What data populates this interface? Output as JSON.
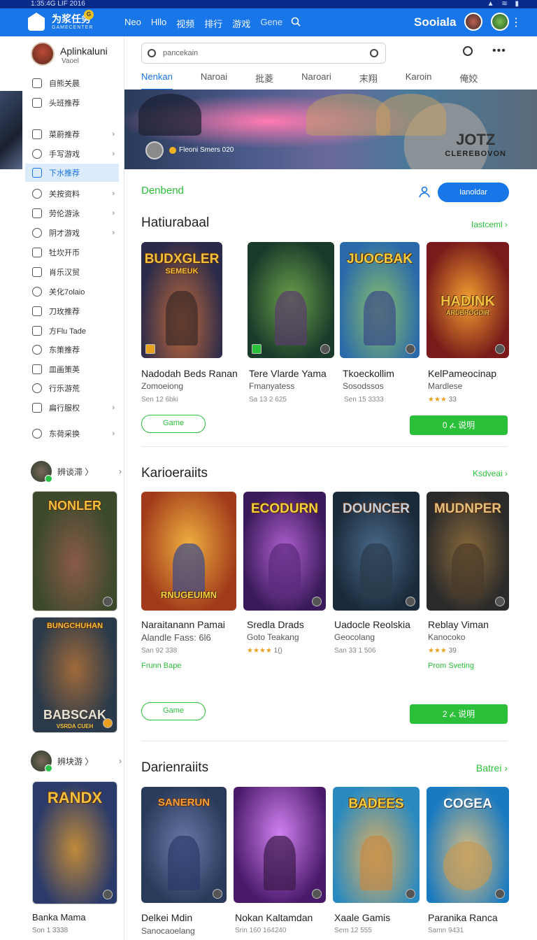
{
  "status": {
    "text": "1:35:4G  LIF 2016",
    "icons": "▲ ≋ ▮"
  },
  "header": {
    "brand": "为浆任务",
    "brand_badge": "G",
    "brand_sub": "GAMECENTER",
    "nav": [
      "Neo",
      "Hllo",
      "视频",
      "排行",
      "游戏",
      "Gene"
    ],
    "social": "Sooiala"
  },
  "sidebar": {
    "profile_name": "Aplinkaluni",
    "profile_sub": "Vaoel",
    "items": [
      {
        "label": "自熊关晨",
        "chev": false
      },
      {
        "label": "头班推荐",
        "chev": false
      },
      {
        "label": "菜蔚推荐",
        "chev": true
      },
      {
        "label": "手写游戏",
        "chev": true
      },
      {
        "label": "下水推荐",
        "chev": false,
        "active": true
      },
      {
        "label": "关按资料",
        "chev": true
      },
      {
        "label": "劳伦游泳",
        "chev": true
      },
      {
        "label": "阴才游戏",
        "chev": true
      },
      {
        "label": "牡坎开币",
        "chev": false
      },
      {
        "label": "肖乐汉贸",
        "chev": false
      },
      {
        "label": "关化7olaio",
        "chev": false
      },
      {
        "label": "刀玫推荐",
        "chev": false
      },
      {
        "label": "方Flu Tade",
        "chev": false
      },
      {
        "label": "东策推荐",
        "chev": false
      },
      {
        "label": "皿画策英",
        "chev": false
      },
      {
        "label": "行乐游荒",
        "chev": false
      },
      {
        "label": "扁行服权",
        "chev": true
      },
      {
        "label": "东荷采换",
        "chev": true
      }
    ],
    "friends": [
      {
        "label": "辨谈滞 〉"
      },
      {
        "label": "辨块游 〉"
      }
    ],
    "cards": [
      {
        "title": "NONLER"
      },
      {
        "title": "BABSCAK",
        "top": "BUNGCHUHAN",
        "subtitle": "VSRDA CUEH"
      },
      {
        "title": "RANDX"
      }
    ],
    "bottom_name": "Banka Mama",
    "bottom_sub": "Son 1 3338"
  },
  "main": {
    "search_placeholder": "pancekain",
    "tabs": [
      "Nenkan",
      "Naroai",
      "批菱",
      "Naroari",
      "末翔",
      "Karoin",
      "俺姣"
    ],
    "hero": {
      "caption": "Fleoni Smers 020",
      "logo_main": "JOTZ",
      "logo_sub": "CLEREBOVON"
    },
    "featured_label": "Denbend",
    "primary_button": "Ianoldar",
    "sections": [
      {
        "title": "Hatiurabaal",
        "link": "Iastceml ›",
        "games": [
          {
            "art": "BUDXGLER",
            "art_sub": "SEMEUK",
            "name": "Nadodah Beds Ranan",
            "sub": "Zomoeiong",
            "meta": "Sen 12 6bki"
          },
          {
            "art": "",
            "name": "Tere Vlarde Yama",
            "sub": "Fmanyatess",
            "meta": "Sa 13 2 625"
          },
          {
            "art": "JUOCBAK",
            "name": "Tkoeckollim",
            "sub": "Sosodssos",
            "meta": "Sen 15 3333"
          },
          {
            "art": "HADINK",
            "art_sub": "ARUBROGDIR",
            "name": "KelPameocinap",
            "sub": "Mardlese",
            "stars": "★★★",
            "rating": "33"
          }
        ],
        "outline_button": "Game",
        "green_button": "0 ፈ 说明"
      },
      {
        "title": "Karioeraiits",
        "link": "Ksdveai ›",
        "games": [
          {
            "art": "RNUGEUIMN",
            "name": "Naraitanann Pamai",
            "sub": "Alandle Fass: 6l6",
            "meta": "San 92 338",
            "green": "Frunn Bape"
          },
          {
            "art": "ECODURN",
            "name": "Sredla Drads",
            "sub": "Goto Teakang",
            "stars": "★★★★",
            "rating": "1()"
          },
          {
            "art": "DOUNCER",
            "name": "Uadocle Reolskia",
            "sub": "Geocolang",
            "meta": "San 33 1 506"
          },
          {
            "art": "MUDNPER",
            "name": "Reblay Viman",
            "sub": "Kanocoko",
            "stars": "★★★",
            "rating": "39",
            "green": "Prom Sveting"
          }
        ],
        "outline_button": "Game",
        "green_button": "2 ፈ 说明"
      },
      {
        "title": "Darienraiits",
        "link": "Batrei ›",
        "games": [
          {
            "art": "SANERUN",
            "name": "Delkei Mdin",
            "sub": "Sanocaoelang"
          },
          {
            "art": "",
            "name": "Nokan Kaltamdan",
            "meta": "Srin 160 164240"
          },
          {
            "art": "BADEES",
            "name": "Xaale Gamis",
            "meta": "Sem 12 555"
          },
          {
            "art": "COGEA",
            "name": "Paranika Ranca",
            "meta": "Samn 9431"
          }
        ]
      }
    ]
  },
  "colors": {
    "accent": "#1976e8",
    "green": "#2bbf3a",
    "star": "#e8a020"
  }
}
